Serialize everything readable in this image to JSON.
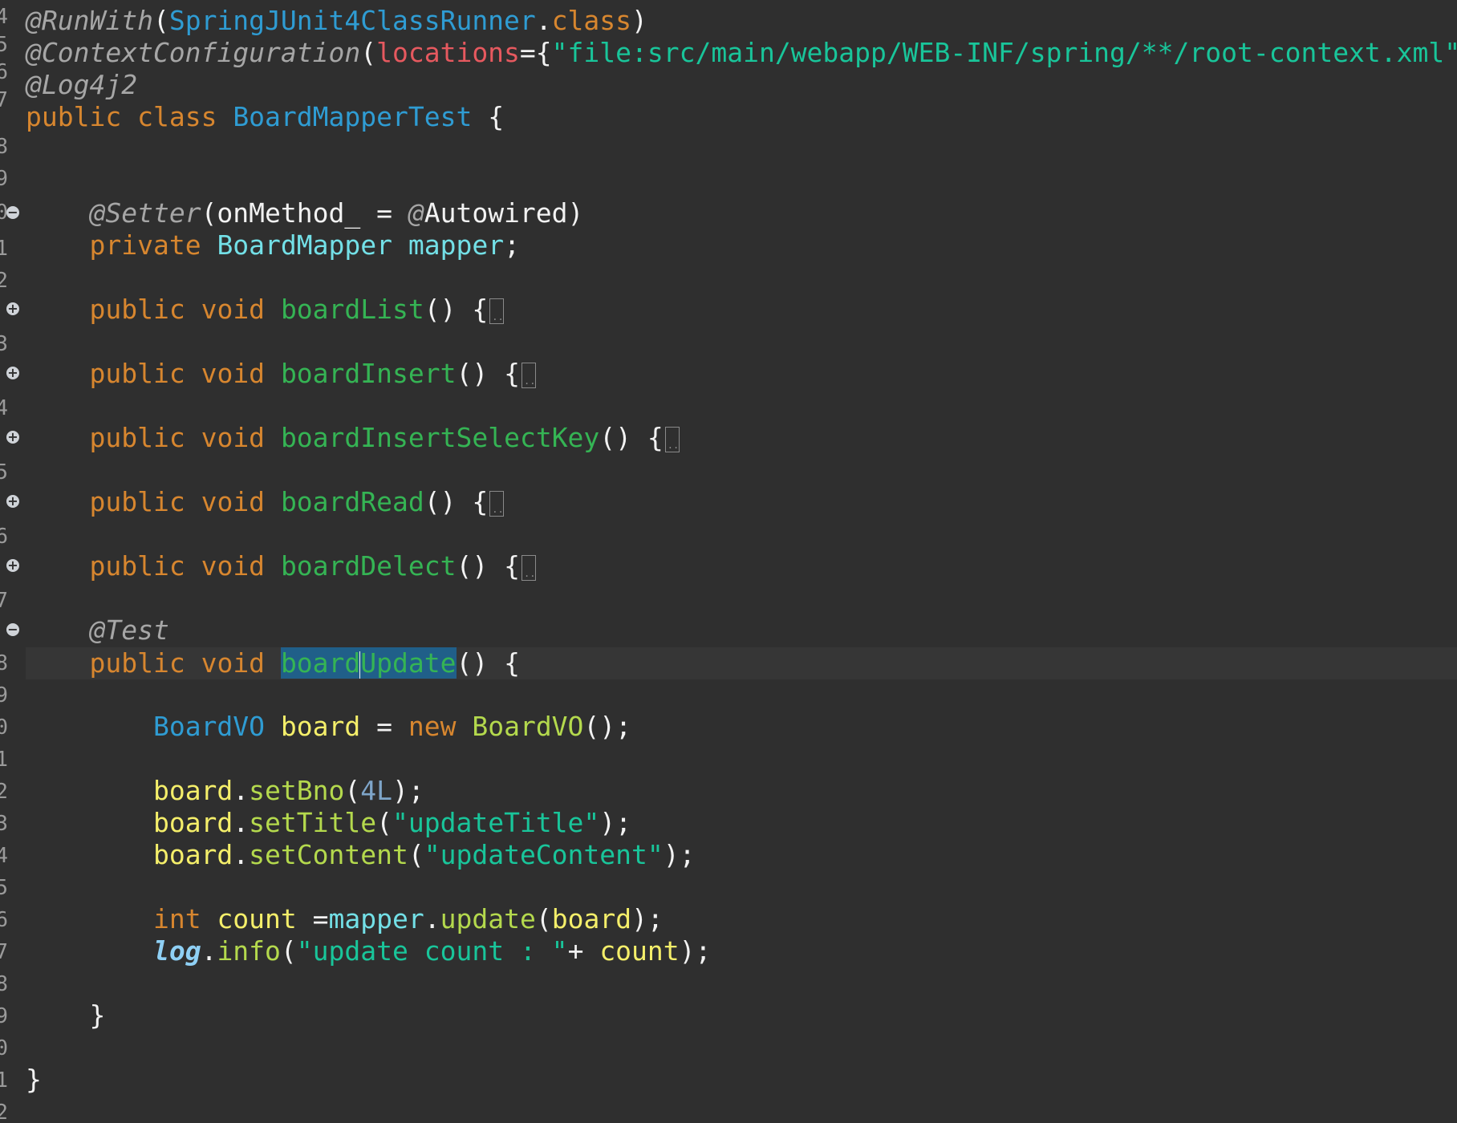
{
  "editor": {
    "gutter_line_numbers": [
      "4",
      "5",
      "6",
      "7",
      "8",
      "9",
      "0",
      "1",
      "2",
      "3",
      "4",
      "5",
      "6",
      "7",
      "8",
      "9",
      "0",
      "1",
      "2",
      "3",
      "4",
      "5",
      "6",
      "7",
      "8",
      "9",
      "0",
      "1",
      "2",
      "3",
      "4",
      "5",
      "6",
      "7",
      "8",
      "9"
    ],
    "lines": {
      "l1": {
        "a": "@RunWith",
        "b": "(",
        "c": "SpringJUnit4ClassRunner",
        "d": ".",
        "e": "class",
        "f": ")"
      },
      "l2": {
        "a": "@ContextConfiguration",
        "b": "(",
        "c": "locations",
        "d": "={",
        "e": "\"file:src/main/webapp/WEB-INF/spring/**/root-context.xml\"",
        "f": "})"
      },
      "l3": {
        "a": "@Log4j2"
      },
      "l4": {
        "a": "public",
        "b": "class",
        "c": "BoardMapperTest",
        "d": "{"
      },
      "l5": {
        "a": "@Setter",
        "b": "(onMethod_ = ",
        "c": "@",
        "d": "Autowired)"
      },
      "l6": {
        "a": "private",
        "b": "BoardMapper",
        "c": "mapper",
        "d": ";"
      },
      "l7": {
        "a": "public",
        "b": "void",
        "c": "boardList",
        "d": "() {"
      },
      "l8": {
        "a": "public",
        "b": "void",
        "c": "boardInsert",
        "d": "() {"
      },
      "l9": {
        "a": "public",
        "b": "void",
        "c": "boardInsertSelectKey",
        "d": "() {"
      },
      "l10": {
        "a": "public",
        "b": "void",
        "c": "boardRead",
        "d": "() {"
      },
      "l11": {
        "a": "public",
        "b": "void",
        "c": "boardDelect",
        "d": "() {"
      },
      "l12": {
        "a": "@Test"
      },
      "l13": {
        "a": "public",
        "b": "void",
        "c1": "board",
        "c2": "Update",
        "d": "() {"
      },
      "l14": {
        "a": "BoardVO",
        "b": "board",
        "c": " = ",
        "d": "new",
        "e": "BoardVO",
        "f": "();"
      },
      "l15": {
        "a": "board",
        "b": ".",
        "c": "setBno",
        "d": "(",
        "e": "4L",
        "f": ");"
      },
      "l16": {
        "a": "board",
        "b": ".",
        "c": "setTitle",
        "d": "(",
        "e": "\"updateTitle\"",
        "f": ");"
      },
      "l17": {
        "a": "board",
        "b": ".",
        "c": "setContent",
        "d": "(",
        "e": "\"updateContent\"",
        "f": ");"
      },
      "l18": {
        "a": "int",
        "b": "count",
        "c": " =",
        "d": "mapper",
        "e": ".",
        "f": "update",
        "g": "(",
        "h": "board",
        "i": ");"
      },
      "l19": {
        "a": "log",
        "b": ".",
        "c": "info",
        "d": "(",
        "e": "\"update count : \"",
        "f": "+ ",
        "g": "count",
        "h": ");"
      },
      "l20": {
        "a": "}"
      },
      "l21": {
        "a": "}"
      }
    },
    "colors": {
      "background": "#2f2f2f",
      "keyword": "#d7862f",
      "string": "#19c59a",
      "method": "#35b454",
      "selection": "#205f89"
    }
  }
}
